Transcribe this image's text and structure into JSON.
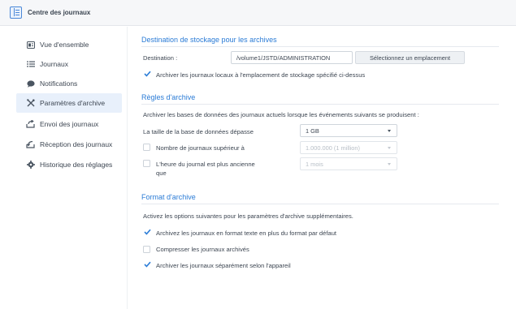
{
  "app": {
    "title": "Centre des journaux"
  },
  "sidebar": {
    "items": [
      {
        "label": "Vue d'ensemble",
        "icon": "overview-icon",
        "active": false
      },
      {
        "label": "Journaux",
        "icon": "list-icon",
        "active": false
      },
      {
        "label": "Notifications",
        "icon": "speech-bubble-icon",
        "active": false
      },
      {
        "label": "Paramètres d'archive",
        "icon": "tools-icon",
        "active": true
      },
      {
        "label": "Envoi des journaux",
        "icon": "send-icon",
        "active": false
      },
      {
        "label": "Réception des journaux",
        "icon": "receive-icon",
        "active": false
      },
      {
        "label": "Historique des réglages",
        "icon": "gear-icon",
        "active": false
      }
    ]
  },
  "storage": {
    "title": "Destination de stockage pour les archives",
    "destination_label": "Destination :",
    "destination_value": "/volume1/JSTD/ADMINISTRATION",
    "select_location_button": "Sélectionnez un emplacement",
    "archive_local_label": "Archiver les journaux locaux à l'emplacement de stockage spécifié ci-dessus",
    "archive_local_checked": true
  },
  "rules": {
    "title": "Règles d'archive",
    "description": "Archiver les bases de données des journaux actuels lorsque les événements suivants se produisent :",
    "db_size_label": "La taille de la base de données dépasse",
    "db_size_value": "1 GB",
    "log_count_label": "Nombre de journaux supérieur à",
    "log_count_value": "1.000.000 (1 million)",
    "log_count_checked": false,
    "log_age_label_line1": "L'heure du journal est plus ancienne",
    "log_age_label_line2": "que",
    "log_age_value": "1 mois",
    "log_age_checked": false
  },
  "format": {
    "title": "Format d'archive",
    "description": "Activez les options suivantes pour les paramètres d'archive supplémentaires.",
    "options": [
      {
        "label": "Archivez les journaux en format texte en plus du format par défaut",
        "checked": true
      },
      {
        "label": "Compresser les journaux archivés",
        "checked": false
      },
      {
        "label": "Archiver les journaux séparément selon l'appareil",
        "checked": true
      }
    ]
  },
  "colors": {
    "accent": "#2a7bd6",
    "active_bg": "#e8f0fb",
    "check": "#2f7fd8"
  }
}
